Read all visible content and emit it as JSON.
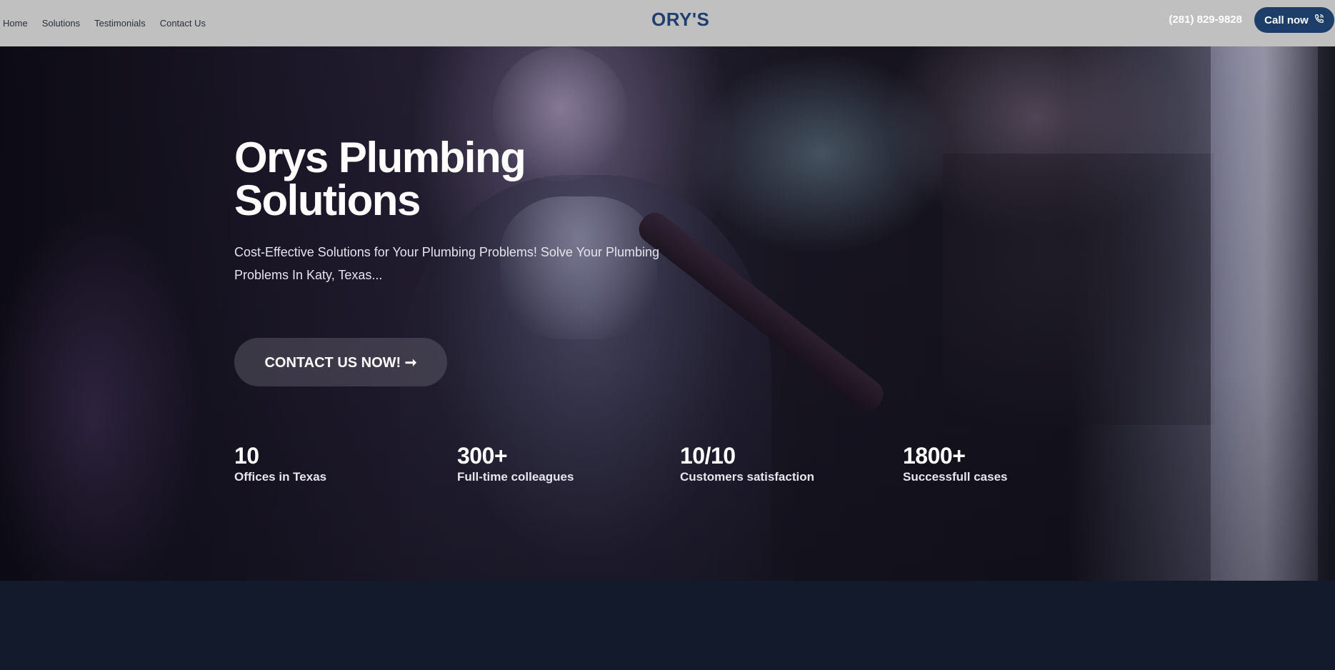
{
  "header": {
    "nav": [
      {
        "label": "Home"
      },
      {
        "label": "Solutions"
      },
      {
        "label": "Testimonials"
      },
      {
        "label": "Contact Us"
      }
    ],
    "logo": "ORY'S",
    "phone": "(281) 829-9828",
    "call_button": "Call now"
  },
  "hero": {
    "title_line1": "Orys Plumbing",
    "title_line2": "Solutions",
    "subtitle": "Cost-Effective Solutions for Your Plumbing Problems! Solve Your Plumbing Problems In Katy, Texas...",
    "cta": "CONTACT US NOW! ➞",
    "stats": [
      {
        "value": "10",
        "label": "Offices in Texas"
      },
      {
        "value": "300+",
        "label": "Full-time colleagues"
      },
      {
        "value": "10/10",
        "label": "Customers satisfaction"
      },
      {
        "value": "1800+",
        "label": "Successfull cases"
      }
    ]
  },
  "colors": {
    "header_bg": "#c0c0c0",
    "brand": "#1f3f6e",
    "call_button_bg": "#1d3e68",
    "lower_bg": "#131a2c"
  },
  "icons": {
    "call_button": "phone-icon"
  }
}
